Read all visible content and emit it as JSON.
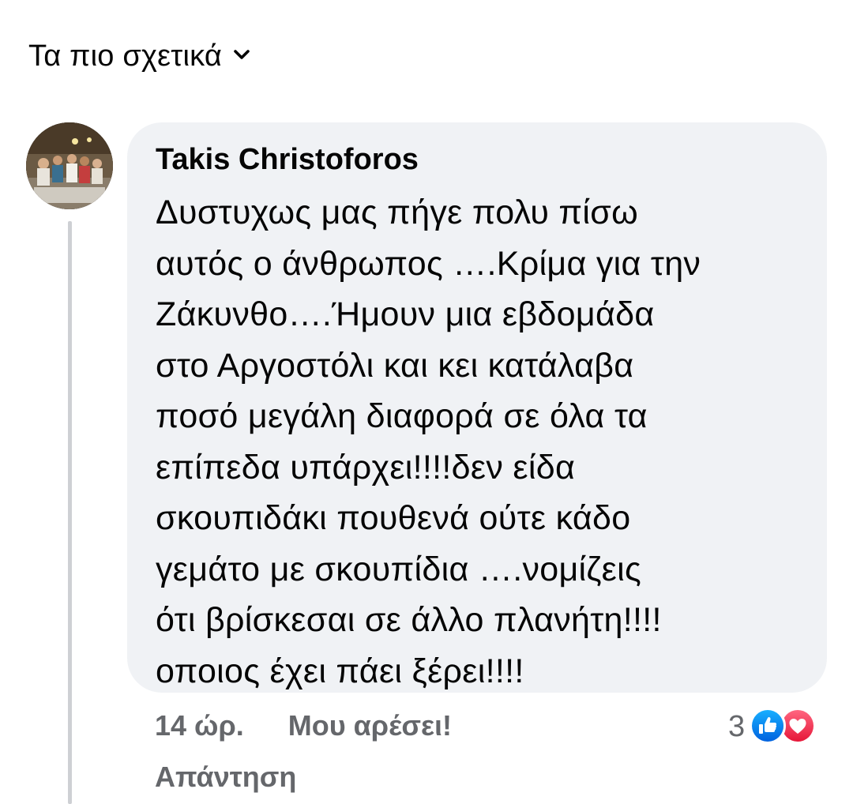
{
  "sort": {
    "label": "Τα πιο σχετικά",
    "icon": "chevron-down-icon"
  },
  "comment": {
    "author": "Takis Christoforos",
    "text": "Δυστυχως μας πήγε πολυ πίσω\nαυτός ο άνθρωπος ….Κρίμα για την\nΖάκυνθο….Ήμουν μια εβδομάδα\nστο Αργοστόλι και κει κατάλαβα\nποσό μεγάλη διαφορά σε όλα τα\nεπίπεδα υπάρχει!!!!δεν είδα\nσκουπιδάκι πουθενά ούτε κάδο\nγεμάτο με σκουπίδια ….νομίζεις\nότι βρίσκεσαι σε άλλο πλανήτη!!!!\nοποιος έχει πάει ξέρει!!!!",
    "time": "14 ώρ.",
    "like_label": "Μου αρέσει!",
    "reply_label": "Απάντηση",
    "reaction_count": "3",
    "reaction_icons": [
      "like-reaction-icon",
      "love-reaction-icon"
    ]
  },
  "colors": {
    "bubble": "#f0f2f5",
    "meta_text": "#65676b",
    "like_blue": "#1877f2",
    "love_red": "#f33e58",
    "thread_line": "#ced0d4"
  }
}
